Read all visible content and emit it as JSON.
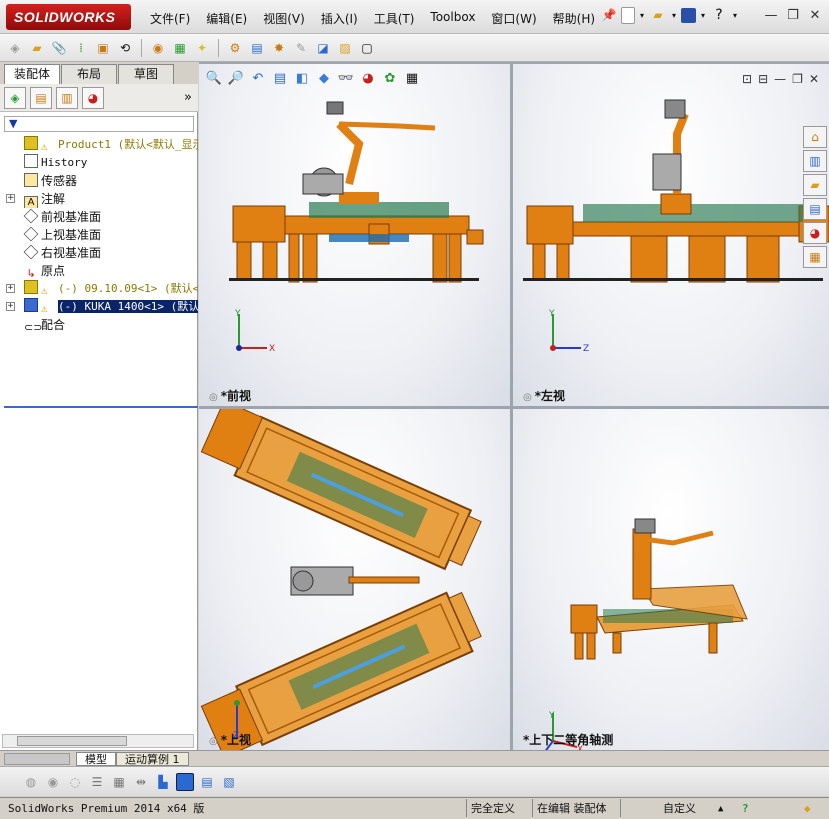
{
  "app": {
    "logo": "SOLIDWORKS"
  },
  "menu": [
    "文件(F)",
    "编辑(E)",
    "视图(V)",
    "插入(I)",
    "工具(T)",
    "Toolbox",
    "窗口(W)",
    "帮助(H)"
  ],
  "left_panel": {
    "tabs": [
      "装配体",
      "布局",
      "草图"
    ],
    "expand_label": "»",
    "tree": [
      {
        "label": "Product1  (默认<默认_显示状",
        "type": "product"
      },
      {
        "label": "History",
        "type": "mono"
      },
      {
        "label": "传感器"
      },
      {
        "label": "注解"
      },
      {
        "label": "前视基准面"
      },
      {
        "label": "上视基准面"
      },
      {
        "label": "右视基准面"
      },
      {
        "label": "原点"
      },
      {
        "label": "(-) 09.10.09<1> (默认<<",
        "type": "product"
      },
      {
        "label": "(-) KUKA 1400<1> (默认<",
        "type": "selected"
      },
      {
        "label": "配合"
      }
    ]
  },
  "viewports": [
    {
      "label": "*前视",
      "axes": [
        "Y",
        "X"
      ]
    },
    {
      "label": "*左视",
      "axes": [
        "Y",
        "Z"
      ]
    },
    {
      "label": "*上视",
      "axes": [
        "Z",
        "X"
      ]
    },
    {
      "label": "*上下二等角轴测",
      "axes": [
        "Y",
        "X",
        "Z"
      ]
    }
  ],
  "bottom_tabs": [
    "模型",
    "运动算例 1"
  ],
  "status": {
    "product": "SolidWorks Premium 2014 x64 版",
    "defined": "完全定义",
    "editing": "在编辑 装配体",
    "custom": "自定义",
    "help": "?"
  },
  "colors": {
    "orange": "#e07f12",
    "dark_orange": "#a95a08",
    "brand_red": "#c8201c",
    "selection": "#0a246a"
  }
}
